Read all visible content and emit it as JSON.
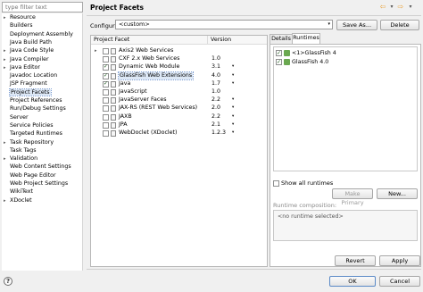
{
  "filter": {
    "placeholder": "type filter text"
  },
  "tree": [
    {
      "label": "Resource",
      "expand": "▸"
    },
    {
      "label": "Builders",
      "expand": ""
    },
    {
      "label": "Deployment Assembly",
      "expand": ""
    },
    {
      "label": "Java Build Path",
      "expand": ""
    },
    {
      "label": "Java Code Style",
      "expand": "▸"
    },
    {
      "label": "Java Compiler",
      "expand": "▸"
    },
    {
      "label": "Java Editor",
      "expand": "▸"
    },
    {
      "label": "Javadoc Location",
      "expand": ""
    },
    {
      "label": "JSP Fragment",
      "expand": ""
    },
    {
      "label": "Project Facets",
      "expand": ""
    },
    {
      "label": "Project References",
      "expand": ""
    },
    {
      "label": "Run/Debug Settings",
      "expand": ""
    },
    {
      "label": "Server",
      "expand": ""
    },
    {
      "label": "Service Policies",
      "expand": ""
    },
    {
      "label": "Targeted Runtimes",
      "expand": ""
    },
    {
      "label": "Task Repository",
      "expand": "▸"
    },
    {
      "label": "Task Tags",
      "expand": ""
    },
    {
      "label": "Validation",
      "expand": "▸"
    },
    {
      "label": "Web Content Settings",
      "expand": ""
    },
    {
      "label": "Web Page Editor",
      "expand": ""
    },
    {
      "label": "Web Project Settings",
      "expand": ""
    },
    {
      "label": "WikiText",
      "expand": ""
    },
    {
      "label": "XDoclet",
      "expand": "▸"
    }
  ],
  "page": {
    "title": "Project Facets",
    "nav_back": "⇦",
    "nav_menu": "▾",
    "nav_forward": "⇨",
    "nav_more": "▾"
  },
  "config": {
    "label": "Configuration:",
    "value": "<custom>",
    "arrow": "▾",
    "save_as": "Save As...",
    "delete": "Delete"
  },
  "facets": {
    "col_facet": "Project Facet",
    "col_version": "Version",
    "rows": [
      {
        "name": "Axis2 Web Services",
        "version": "",
        "checked": false,
        "dropdown": "",
        "expand": "▸"
      },
      {
        "name": "CXF 2.x Web Services",
        "version": "1.0",
        "checked": false,
        "dropdown": "",
        "expand": ""
      },
      {
        "name": "Dynamic Web Module",
        "version": "3.1",
        "checked": true,
        "dropdown": "▾",
        "expand": ""
      },
      {
        "name": "GlassFish Web Extensions",
        "version": "4.0",
        "checked": true,
        "dropdown": "▾",
        "expand": ""
      },
      {
        "name": "Java",
        "version": "1.7",
        "checked": true,
        "dropdown": "▾",
        "expand": ""
      },
      {
        "name": "JavaScript",
        "version": "1.0",
        "checked": false,
        "dropdown": "",
        "expand": ""
      },
      {
        "name": "JavaServer Faces",
        "version": "2.2",
        "checked": false,
        "dropdown": "▾",
        "expand": ""
      },
      {
        "name": "JAX-RS (REST Web Services)",
        "version": "2.0",
        "checked": false,
        "dropdown": "▾",
        "expand": ""
      },
      {
        "name": "JAXB",
        "version": "2.2",
        "checked": false,
        "dropdown": "▾",
        "expand": ""
      },
      {
        "name": "JPA",
        "version": "2.1",
        "checked": false,
        "dropdown": "▾",
        "expand": ""
      },
      {
        "name": "WebDoclet (XDoclet)",
        "version": "1.2.3",
        "checked": false,
        "dropdown": "▾",
        "expand": ""
      }
    ]
  },
  "tabs": {
    "details": "Details",
    "runtimes": "Runtimes"
  },
  "runtimes": {
    "items": [
      {
        "label": "<1>GlassFish 4",
        "checked": true
      },
      {
        "label": "GlassFish 4.0",
        "checked": true
      }
    ],
    "show_all": "Show all runtimes",
    "make_primary": "Make Primary",
    "new": "New...",
    "composition_label": "Runtime composition:",
    "composition_value": "<no runtime selected>"
  },
  "actions": {
    "revert": "Revert",
    "apply": "Apply",
    "ok": "OK",
    "cancel": "Cancel",
    "help": "?"
  },
  "colors": {
    "selection": "#dde8f6",
    "accent": "#e8a23a",
    "glassfish": "#6aa850"
  }
}
